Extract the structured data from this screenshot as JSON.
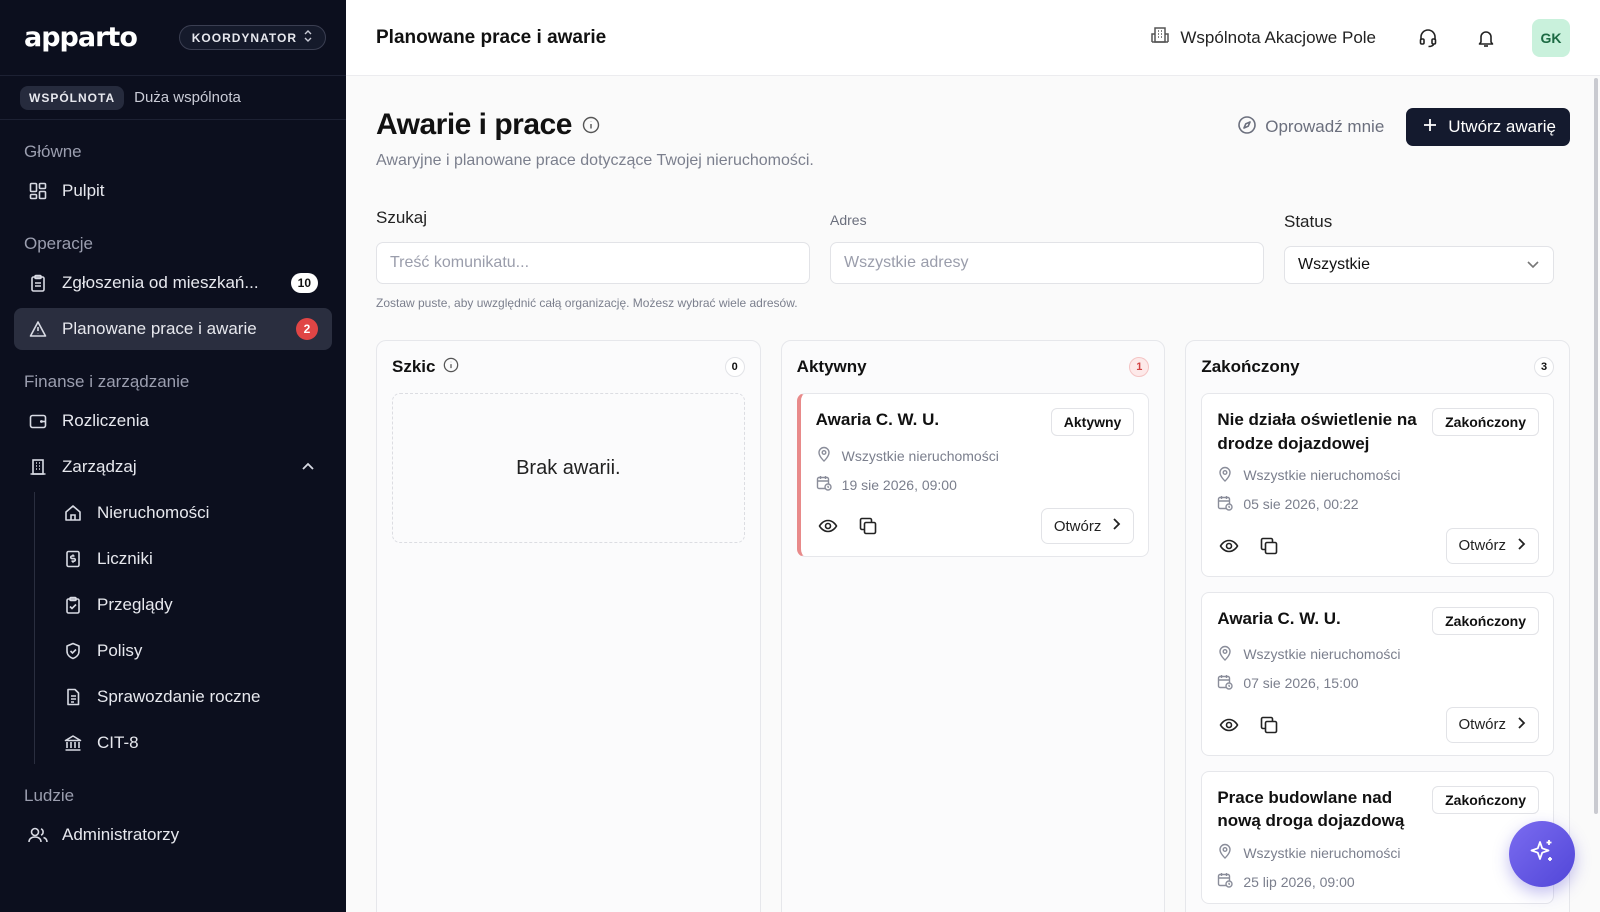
{
  "sidebar": {
    "logo": "apparto",
    "role": "KOORDYNATOR",
    "community_tag": "WSPÓLNOTA",
    "community_name": "Duża wspólnota",
    "sections": {
      "main": "Główne",
      "operations": "Operacje",
      "finance": "Finanse i zarządzanie",
      "people": "Ludzie"
    },
    "items": {
      "dashboard": "Pulpit",
      "requests": "Zgłoszenia od mieszkań...",
      "requests_badge": "10",
      "works": "Planowane prace i awarie",
      "works_badge": "2",
      "billing": "Rozliczenia",
      "manage": "Zarządzaj",
      "properties": "Nieruchomości",
      "meters": "Liczniki",
      "inspections": "Przeglądy",
      "policies": "Polisy",
      "annual_report": "Sprawozdanie roczne",
      "cit8": "CIT-8",
      "admins": "Administratorzy"
    }
  },
  "topbar": {
    "title": "Planowane prace i awarie",
    "community": "Wspólnota Akacjowe Pole",
    "avatar": "GK"
  },
  "page": {
    "title": "Awarie i prace",
    "subtitle": "Awaryjne i planowane prace dotyczące Twojej nieruchomości.",
    "guide": "Oprowadź mnie",
    "create": "Utwórz awarię"
  },
  "filters": {
    "search_label": "Szukaj",
    "search_placeholder": "Treść komunikatu...",
    "address_label": "Adres",
    "address_placeholder": "Wszystkie adresy",
    "status_label": "Status",
    "status_value": "Wszystkie",
    "hint": "Zostaw puste, aby uwzględnić całą organizację. Możesz wybrać wiele adresów."
  },
  "columns": {
    "draft": {
      "title": "Szkic",
      "count": "0",
      "empty": "Brak awarii."
    },
    "active": {
      "title": "Aktywny",
      "count": "1",
      "cards": [
        {
          "title": "Awaria C. W. U.",
          "status": "Aktywny",
          "location": "Wszystkie nieruchomości",
          "date": "19 sie 2026, 09:00",
          "open": "Otwórz"
        }
      ]
    },
    "done": {
      "title": "Zakończony",
      "count": "3",
      "cards": [
        {
          "title": "Nie działa oświetlenie na drodze dojazdowej",
          "status": "Zakończony",
          "location": "Wszystkie nieruchomości",
          "date": "05 sie 2026, 00:22",
          "open": "Otwórz"
        },
        {
          "title": "Awaria C. W. U.",
          "status": "Zakończony",
          "location": "Wszystkie nieruchomości",
          "date": "07 sie 2026, 15:00",
          "open": "Otwórz"
        },
        {
          "title": "Prace budowlane nad nową droga dojazdową",
          "status": "Zakończony",
          "location": "Wszystkie nieruchomości",
          "date": "25 lip 2026, 09:00"
        }
      ]
    }
  }
}
